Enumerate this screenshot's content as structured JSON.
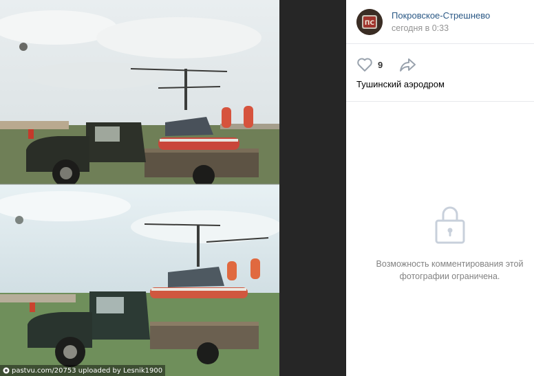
{
  "photo": {
    "watermark": "pastvu.com/20753  uploaded by Lesnik1900"
  },
  "post": {
    "author_name": "Покровское-Стрешнево",
    "time": "сегодня в 0:33",
    "likes": "9",
    "caption": "Тушинский аэродром"
  },
  "comments": {
    "closed_line1": "Возможность комментирования этой",
    "closed_line2": "фотографии ограничена."
  },
  "icons": {
    "avatar": "logo-pcs",
    "like": "heart-icon",
    "share": "share-arrow-icon",
    "lock": "lock-icon",
    "watermark": "pastvu-logo-icon"
  },
  "colors": {
    "link": "#2a5885",
    "muted": "#939393",
    "icon": "#99a2ad",
    "divider": "#e7e8ec"
  }
}
